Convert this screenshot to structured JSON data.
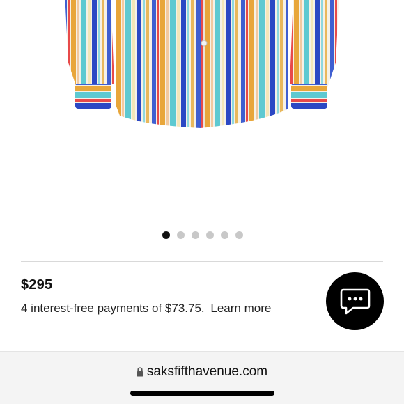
{
  "product": {
    "image_alt": "striped shirt",
    "carousel": {
      "total": 6,
      "active_index": 0
    }
  },
  "pricing": {
    "price": "$295",
    "installments_text": "4 interest-free payments of $73.75.",
    "learn_more": "Learn more"
  },
  "chat": {
    "icon": "chat-bubble-icon"
  },
  "browser": {
    "url": "saksfifthavenue.com",
    "lock_icon": "lock-icon"
  },
  "colors": {
    "accent": "#000000",
    "divider": "#d9d9d9",
    "dot_inactive": "#c8c8c8",
    "browser_bar": "#f4f4f4"
  }
}
